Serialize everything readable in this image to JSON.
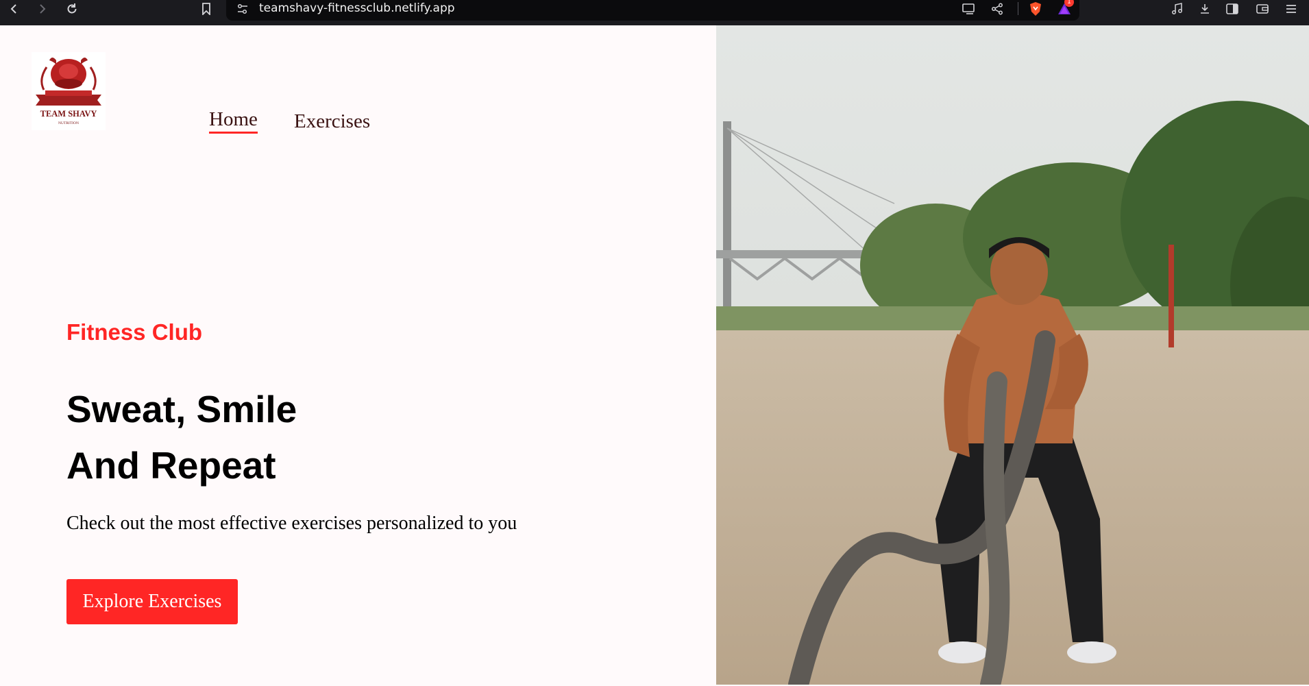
{
  "browser": {
    "url": "teamshavy-fitnessclub.netlify.app",
    "notification_count": "1"
  },
  "logo": {
    "text_main": "TEAM SHAVY",
    "text_sub": "NUTRITION"
  },
  "nav": {
    "items": [
      {
        "label": "Home"
      },
      {
        "label": "Exercises"
      }
    ]
  },
  "hero": {
    "eyebrow": "Fitness Club",
    "headline_line1": "Sweat, Smile",
    "headline_line2": "And Repeat",
    "subtext": "Check out the most effective exercises personalized to you",
    "cta_label": "Explore Exercises"
  },
  "colors": {
    "accent": "#ff2625",
    "page_bg": "#fffafb",
    "logo_red": "#a01f1f"
  }
}
